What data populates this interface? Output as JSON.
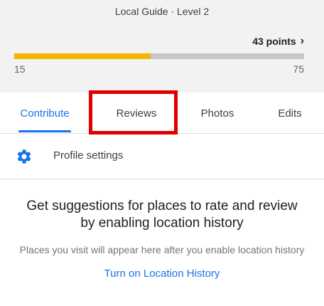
{
  "header": {
    "guide_level": "Local Guide · Level 2",
    "points": "43 points",
    "progress_fraction": 0.47,
    "range_min": "15",
    "range_max": "75",
    "progress_color": "#f5b400"
  },
  "tabs": [
    {
      "label": "Contribute",
      "active": true
    },
    {
      "label": "Reviews",
      "active": false
    },
    {
      "label": "Photos",
      "active": false
    },
    {
      "label": "Edits",
      "active": false
    }
  ],
  "profile": {
    "label": "Profile settings",
    "icon": "gear-icon"
  },
  "suggestion": {
    "title_line1": "Get suggestions for places to rate and review",
    "title_line2": "by enabling location history",
    "subtitle": "Places you visit will appear here after you enable location history",
    "link": "Turn on Location History"
  },
  "colors": {
    "accent": "#1a73e8",
    "highlight": "#e00000"
  }
}
